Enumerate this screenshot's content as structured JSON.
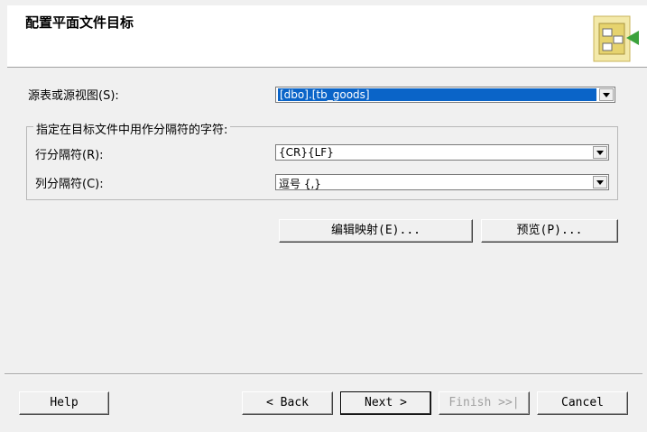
{
  "header": {
    "title": "配置平面文件目标",
    "icon": "file-destination-icon"
  },
  "source": {
    "label": "源表或源视图(S):",
    "value": "[dbo].[tb_goods]"
  },
  "delimiters": {
    "group_title": "指定在目标文件中用作分隔符的字符:",
    "row_label": "行分隔符(R):",
    "row_value": "{CR}{LF}",
    "col_label": "列分隔符(C):",
    "col_value": "逗号 {,}"
  },
  "actions": {
    "edit_mappings": "编辑映射(E)...",
    "preview": "预览(P)..."
  },
  "footer": {
    "help": "Help",
    "back": "< Back",
    "next": "Next >",
    "finish": "Finish >>|",
    "cancel": "Cancel"
  },
  "colors": {
    "selection": "#0a64c8",
    "background": "#f0f0f0"
  }
}
